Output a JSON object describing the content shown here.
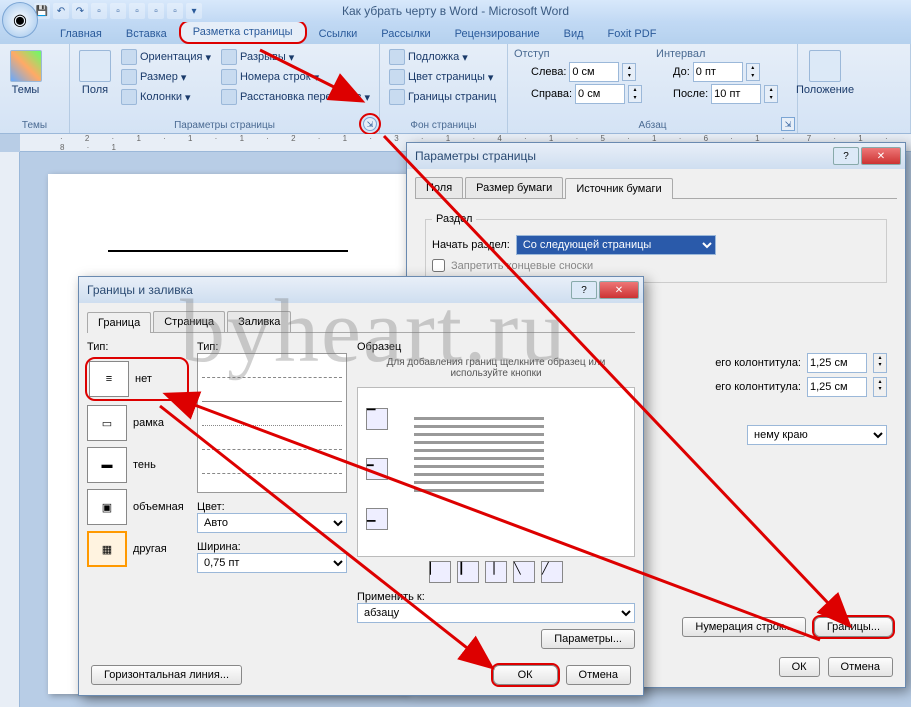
{
  "window": {
    "title": "Как убрать черту в Word - Microsoft Word"
  },
  "tabs": {
    "home": "Главная",
    "insert": "Вставка",
    "layout": "Разметка страницы",
    "refs": "Ссылки",
    "mail": "Рассылки",
    "review": "Рецензирование",
    "view": "Вид",
    "foxit": "Foxit PDF"
  },
  "ribbon": {
    "themes": {
      "label": "Темы",
      "btn": "Темы"
    },
    "page_setup": {
      "label": "Параметры страницы",
      "fields": "Поля",
      "orient": "Ориентация",
      "size": "Размер",
      "columns": "Колонки",
      "breaks": "Разрывы",
      "linenum": "Номера строк",
      "hyphen": "Расстановка переносов"
    },
    "page_bg": {
      "label": "Фон страницы",
      "watermark": "Подложка",
      "color": "Цвет страницы",
      "borders": "Границы страниц"
    },
    "indent": {
      "title": "Отступ",
      "left_lbl": "Слева:",
      "right_lbl": "Справа:",
      "left": "0 см",
      "right": "0 см"
    },
    "spacing": {
      "title": "Интервал",
      "before_lbl": "До:",
      "after_lbl": "После:",
      "before": "0 пт",
      "after": "10 пт"
    },
    "paragraph_label": "Абзац",
    "arrange": "Положение"
  },
  "ruler_marks": "· 2 · 1 · 1 · 1 · 2 · 1 · 3 · 1 · 4 · 1 · 5 · 1 · 6 · 1 · 7 · 1 · 8 · 1",
  "page_setup_dlg": {
    "title": "Параметры страницы",
    "tab_fields": "Поля",
    "tab_paper": "Размер бумаги",
    "tab_source": "Источник бумаги",
    "section": "Раздел",
    "start_section": "Начать раздел:",
    "start_value": "Со следующей страницы",
    "suppress": "Запретить концевые сноски",
    "header_dist": "его колонтитула:",
    "footer_dist": "его колонтитула:",
    "dist1": "1,25 см",
    "dist2": "1,25 см",
    "align": "нему краю",
    "linenum_btn": "Нумерация строк...",
    "borders_btn": "Границы...",
    "ok": "ОК",
    "cancel": "Отмена"
  },
  "borders_dlg": {
    "title": "Границы и заливка",
    "tab_border": "Граница",
    "tab_page": "Страница",
    "tab_shading": "Заливка",
    "type_label": "Тип:",
    "types": {
      "none": "нет",
      "box": "рамка",
      "shadow": "тень",
      "threed": "объемная",
      "custom": "другая"
    },
    "style_label": "Тип:",
    "color_label": "Цвет:",
    "color_value": "Авто",
    "width_label": "Ширина:",
    "width_value": "0,75 пт",
    "preview_label": "Образец",
    "preview_hint": "Для добавления границ щелкните образец или используйте кнопки",
    "apply_label": "Применить к:",
    "apply_value": "абзацу",
    "params": "Параметры...",
    "hline": "Горизонтальная линия...",
    "ok": "ОК",
    "cancel": "Отмена"
  },
  "watermark": "byheart.ru"
}
